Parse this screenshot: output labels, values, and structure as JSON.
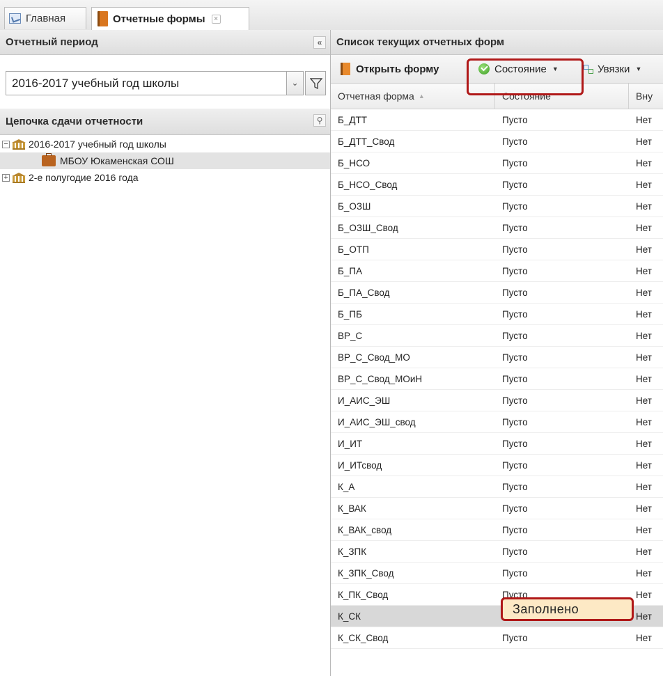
{
  "tabs": [
    {
      "label": "Главная",
      "active": false
    },
    {
      "label": "Отчетные формы",
      "active": true,
      "close_icon": "close-icon"
    }
  ],
  "left_panel": {
    "period_title": "Отчетный период",
    "period_value": "2016-2017 учебный год школы",
    "chain_title": "Цепочка сдачи отчетности",
    "tree": [
      {
        "label": "2016-2017 учебный год школы",
        "expanded": true,
        "icon": "institution-icon"
      },
      {
        "label": "МБОУ Юкаменская СОШ",
        "selected": true,
        "icon": "briefcase-icon"
      },
      {
        "label": "2-е полугодие 2016 года",
        "expanded": false,
        "icon": "institution-icon"
      }
    ]
  },
  "right_panel": {
    "title": "Список текущих отчетных форм",
    "toolbar": {
      "open_label": "Открыть форму",
      "state_label": "Состояние",
      "links_label": "Увязки"
    },
    "columns": [
      "Отчетная форма",
      "Состояние",
      "Вну"
    ],
    "rows": [
      {
        "form": "Б_ДТТ",
        "state": "Пусто",
        "ext": "Нет"
      },
      {
        "form": "Б_ДТТ_Свод",
        "state": "Пусто",
        "ext": "Нет"
      },
      {
        "form": "Б_НСО",
        "state": "Пусто",
        "ext": "Нет"
      },
      {
        "form": "Б_НСО_Свод",
        "state": "Пусто",
        "ext": "Нет"
      },
      {
        "form": "Б_ОЗШ",
        "state": "Пусто",
        "ext": "Нет"
      },
      {
        "form": "Б_ОЗШ_Свод",
        "state": "Пусто",
        "ext": "Нет"
      },
      {
        "form": "Б_ОТП",
        "state": "Пусто",
        "ext": "Нет"
      },
      {
        "form": "Б_ПА",
        "state": "Пусто",
        "ext": "Нет"
      },
      {
        "form": "Б_ПА_Свод",
        "state": "Пусто",
        "ext": "Нет"
      },
      {
        "form": "Б_ПБ",
        "state": "Пусто",
        "ext": "Нет"
      },
      {
        "form": "ВР_С",
        "state": "Пусто",
        "ext": "Нет"
      },
      {
        "form": "ВР_С_Свод_МО",
        "state": "Пусто",
        "ext": "Нет"
      },
      {
        "form": "ВР_С_Свод_МОиН",
        "state": "Пусто",
        "ext": "Нет"
      },
      {
        "form": "И_АИС_ЭШ",
        "state": "Пусто",
        "ext": "Нет"
      },
      {
        "form": "И_АИС_ЭШ_свод",
        "state": "Пусто",
        "ext": "Нет"
      },
      {
        "form": "И_ИТ",
        "state": "Пусто",
        "ext": "Нет"
      },
      {
        "form": "И_ИТсвод",
        "state": "Пусто",
        "ext": "Нет"
      },
      {
        "form": "К_А",
        "state": "Пусто",
        "ext": "Нет"
      },
      {
        "form": "К_ВАК",
        "state": "Пусто",
        "ext": "Нет"
      },
      {
        "form": "К_ВАК_свод",
        "state": "Пусто",
        "ext": "Нет"
      },
      {
        "form": "К_ЗПК",
        "state": "Пусто",
        "ext": "Нет"
      },
      {
        "form": "К_ЗПК_Свод",
        "state": "Пусто",
        "ext": "Нет"
      },
      {
        "form": "К_ПК_Свод",
        "state": "Пусто",
        "ext": "Нет"
      },
      {
        "form": "К_СК",
        "state": "Заполнено",
        "ext": "Нет",
        "selected": true
      },
      {
        "form": "К_СК_Свод",
        "state": "Пусто",
        "ext": "Нет"
      }
    ]
  },
  "colors": {
    "highlight": "#b01818",
    "filled_bg": "#fde9c5",
    "selected_row": "#d8d8d8"
  }
}
